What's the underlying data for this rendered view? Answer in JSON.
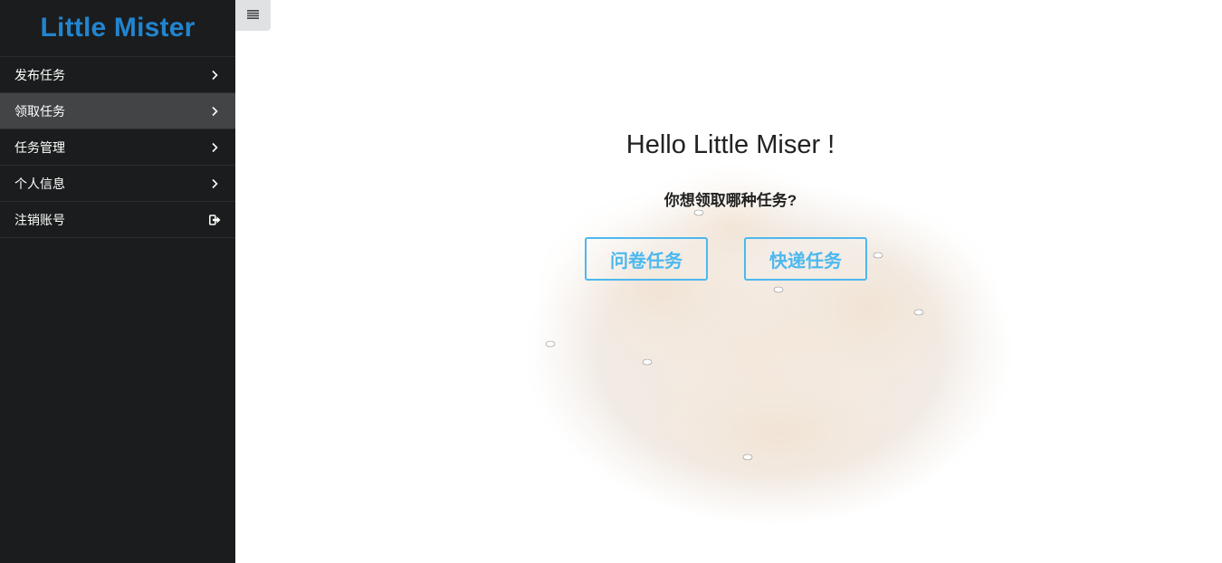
{
  "sidebar": {
    "brand": "Little Mister",
    "items": [
      {
        "label": "发布任务",
        "icon": "chevron-right-icon"
      },
      {
        "label": "领取任务",
        "icon": "chevron-right-icon",
        "active": true
      },
      {
        "label": "任务管理",
        "icon": "chevron-right-icon"
      },
      {
        "label": "个人信息",
        "icon": "chevron-right-icon"
      },
      {
        "label": "注销账号",
        "icon": "sign-out-icon"
      }
    ]
  },
  "toolbar": {
    "menu_toggle_icon": "hamburger-icon"
  },
  "main": {
    "greeting": "Hello Little Miser !",
    "question": "你想领取哪种任务?",
    "buttons": {
      "survey": "问卷任务",
      "express": "快递任务"
    }
  },
  "colors": {
    "sidebar_bg": "#1b1c1d",
    "sidebar_active": "#434446",
    "brand": "#2185d0",
    "button_accent": "#4cb8ee",
    "toggle_bg": "#e0e1e2"
  }
}
